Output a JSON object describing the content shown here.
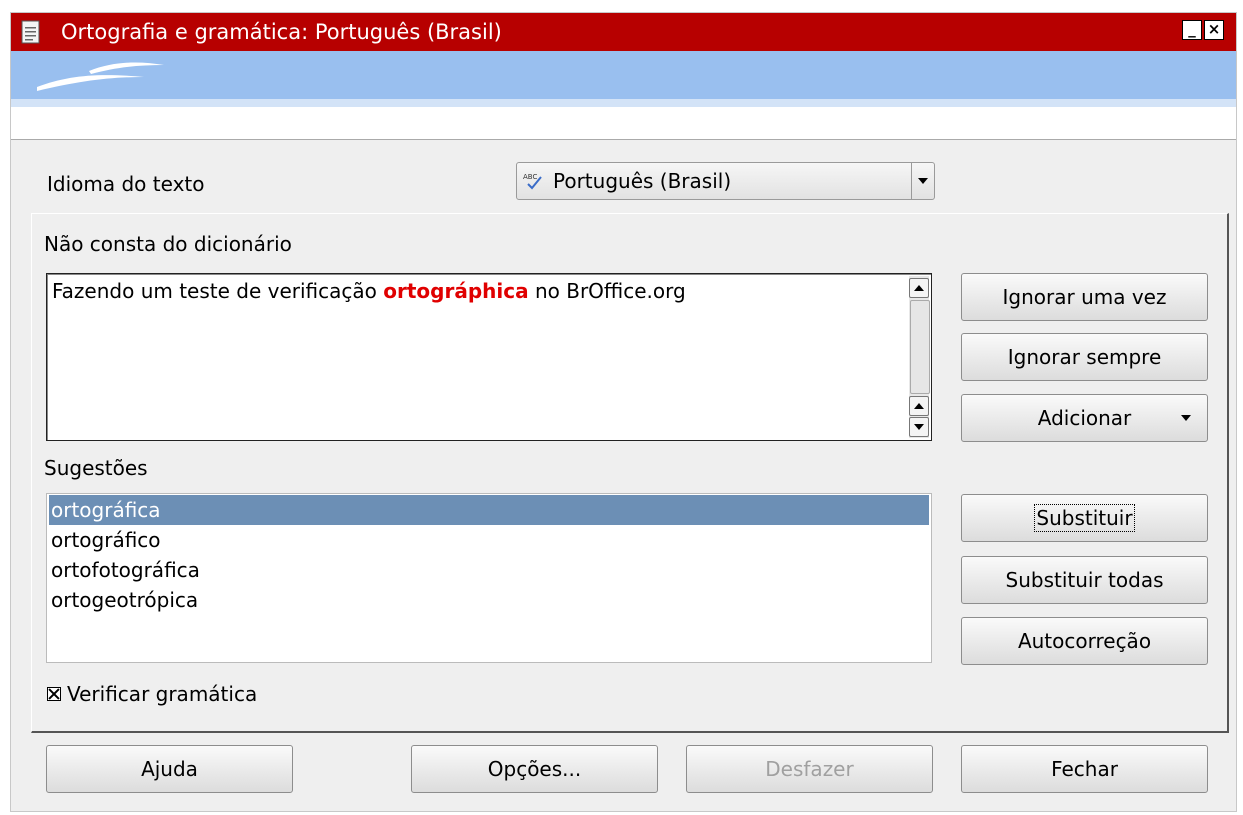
{
  "window": {
    "title": "Ortografia e gramática: Português (Brasil)"
  },
  "language": {
    "label": "Idioma do texto",
    "selected": "Português (Brasil)"
  },
  "not_in_dictionary": {
    "label": "Não consta do dicionário",
    "sentence_before": "Fazendo um teste de verificação ",
    "error_word": "ortográphica",
    "sentence_after": " no BrOffice.org"
  },
  "suggestions": {
    "label": "Sugestões",
    "items": [
      "ortográfica",
      "ortográfico",
      "ortofotográfica",
      "ortogeotrópica"
    ],
    "selected_index": 0
  },
  "buttons": {
    "ignore_once": "Ignorar uma vez",
    "ignore_always": "Ignorar sempre",
    "add": "Adicionar",
    "replace": "Substituir",
    "replace_all": "Substituir todas",
    "autocorrect": "Autocorreção"
  },
  "check_grammar": {
    "label": "Verificar gramática",
    "checked": true
  },
  "footer": {
    "help": "Ajuda",
    "options": "Opções...",
    "undo": "Desfazer",
    "close": "Fechar"
  },
  "colors": {
    "titlebar": "#b70000",
    "banner": "#99bfef",
    "selection": "#6c8fb5",
    "error_text": "#e00000"
  }
}
